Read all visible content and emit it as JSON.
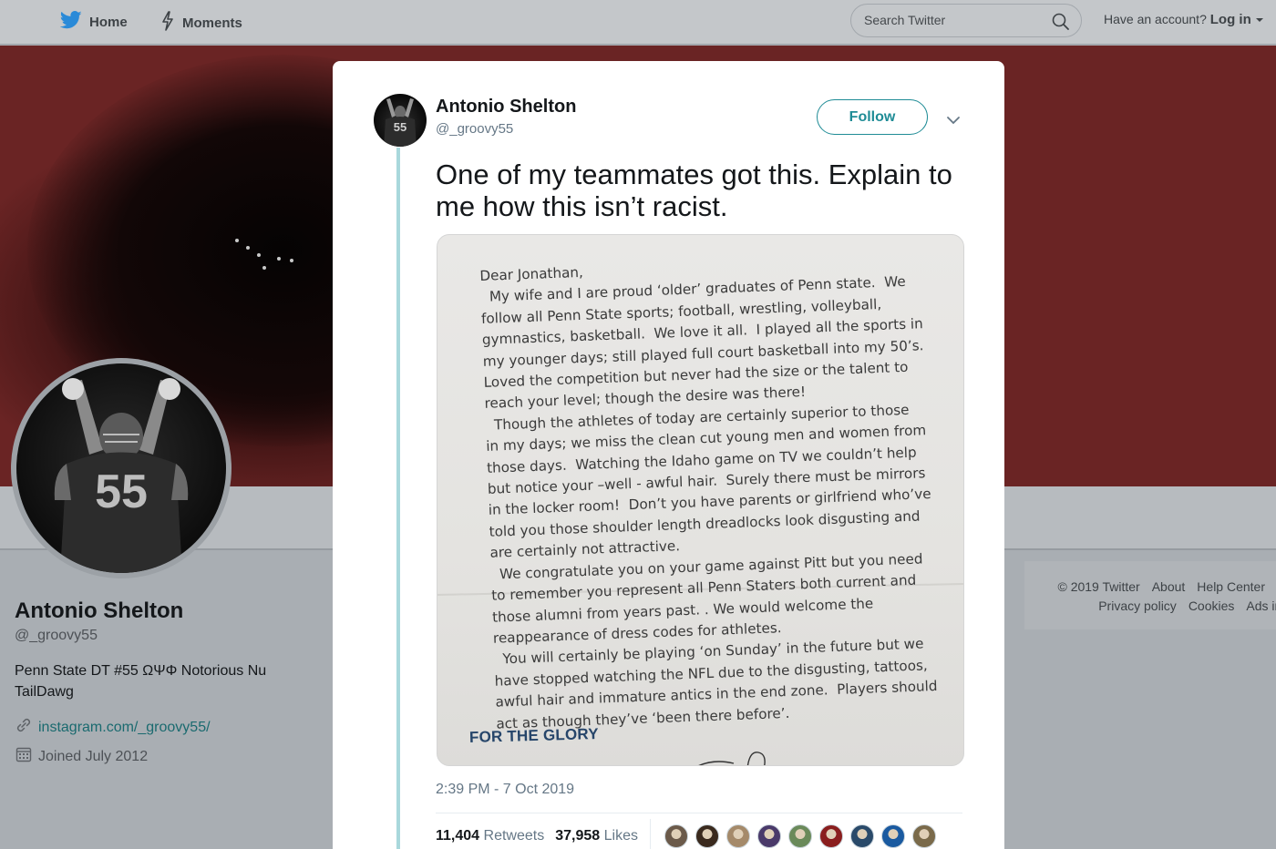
{
  "nav": {
    "home_label": "Home",
    "moments_label": "Moments",
    "search_placeholder": "Search Twitter",
    "account_prompt": "Have an account?",
    "login_label": "Log in"
  },
  "profile": {
    "name": "Antonio Shelton",
    "handle": "@_groovy55",
    "bio": "Penn State DT #55 ΩΨΦ Notorious Nu TailDawg",
    "link": "instagram.com/_groovy55/",
    "joined": "Joined July 2012",
    "jersey_number": "55"
  },
  "footer": {
    "row1": [
      "© 2019 Twitter",
      "About",
      "Help Center"
    ],
    "row2": [
      "Privacy policy",
      "Cookies",
      "Ads info"
    ]
  },
  "tweet": {
    "author_name": "Antonio Shelton",
    "author_handle": "@_groovy55",
    "follow_label": "Follow",
    "text": "One of my teammates got this. Explain to me how this isn’t racist.",
    "timestamp": "2:39 PM - 7 Oct 2019",
    "retweets_count": "11,404",
    "retweets_label": "Retweets",
    "likes_count": "37,958",
    "likes_label": "Likes",
    "liker_colors": [
      "#6b5a4a",
      "#3a2a1e",
      "#a58a6a",
      "#4a3a6a",
      "#6a8a5a",
      "#8a1e1e",
      "#2a4a6a",
      "#1a5aa0",
      "#7a6a4a"
    ]
  },
  "letter": {
    "body": "Dear Jonathan,\n  My wife and I are proud ‘older’ graduates of Penn state.  We\nfollow all Penn State sports; football, wrestling, volleyball,\ngymnastics, basketball.  We love it all.  I played all the sports in\nmy younger days; still played full court basketball into my 50’s.\nLoved the competition but never had the size or the talent to\nreach your level; though the desire was there!\n  Though the athletes of today are certainly superior to those\nin my days; we miss the clean cut young men and women from\nthose days.  Watching the Idaho game on TV we couldn’t help\nbut notice your –well - awful hair.  Surely there must be mirrors\nin the locker room!  Don’t you have parents or girlfriend who’ve\ntold you those shoulder length dreadlocks look disgusting and\nare certainly not attractive.\n  We congratulate you on your game against Pitt but you need\nto remember you represent all Penn Staters both current and\nthose alumni from years past. . We would welcome the\nreappearance of dress codes for athletes.\n  You will certainly be playing ‘on Sunday’ in the future but we\nhave stopped watching the NFL due to the disgusting, tattoos,\nawful hair and immature antics in the end zone.  Players should\nact as though they’ve ‘been there before’.",
    "sign_off": "FOR THE GLORY"
  }
}
